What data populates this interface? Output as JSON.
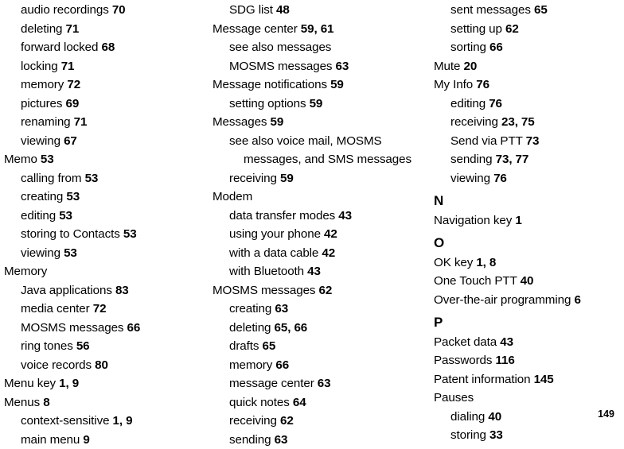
{
  "document": {
    "type": "index",
    "folio": "149"
  },
  "columns": [
    {
      "name": "column-left",
      "entries": [
        {
          "level": 1,
          "text": "audio recordings ",
          "pages": "70"
        },
        {
          "level": 1,
          "text": "deleting ",
          "pages": "71"
        },
        {
          "level": 1,
          "text": "forward locked ",
          "pages": "68"
        },
        {
          "level": 1,
          "text": "locking ",
          "pages": "71"
        },
        {
          "level": 1,
          "text": "memory ",
          "pages": "72"
        },
        {
          "level": 1,
          "text": "pictures ",
          "pages": "69"
        },
        {
          "level": 1,
          "text": "renaming ",
          "pages": "71"
        },
        {
          "level": 1,
          "text": "viewing ",
          "pages": "67"
        },
        {
          "level": 0,
          "text": "Memo ",
          "pages": "53"
        },
        {
          "level": 1,
          "text": "calling from ",
          "pages": "53"
        },
        {
          "level": 1,
          "text": "creating ",
          "pages": "53"
        },
        {
          "level": 1,
          "text": "editing ",
          "pages": "53"
        },
        {
          "level": 1,
          "text": "storing to Contacts ",
          "pages": "53"
        },
        {
          "level": 1,
          "text": "viewing ",
          "pages": "53"
        },
        {
          "level": 0,
          "text": "Memory",
          "pages": ""
        },
        {
          "level": 1,
          "text": "Java applications ",
          "pages": "83"
        },
        {
          "level": 1,
          "text": "media center ",
          "pages": "72"
        },
        {
          "level": 1,
          "text": "MOSMS messages ",
          "pages": "66"
        },
        {
          "level": 1,
          "text": "ring tones ",
          "pages": "56"
        },
        {
          "level": 1,
          "text": "voice records ",
          "pages": "80"
        },
        {
          "level": 0,
          "text": "Menu key ",
          "pages": "1, 9"
        },
        {
          "level": 0,
          "text": "Menus ",
          "pages": "8"
        },
        {
          "level": 1,
          "text": "context-sensitive ",
          "pages": "1, 9"
        },
        {
          "level": 1,
          "text": "main menu ",
          "pages": "9"
        }
      ]
    },
    {
      "name": "column-middle",
      "entries": [
        {
          "level": 1,
          "text": "SDG list ",
          "pages": "48"
        },
        {
          "level": 0,
          "text": "Message center ",
          "pages": "59, 61"
        },
        {
          "level": 1,
          "text": "see also messages",
          "pages": ""
        },
        {
          "level": 1,
          "text": "MOSMS messages ",
          "pages": "63"
        },
        {
          "level": 0,
          "text": "Message notifications ",
          "pages": "59"
        },
        {
          "level": 1,
          "text": "setting options ",
          "pages": "59"
        },
        {
          "level": 0,
          "text": "Messages ",
          "pages": "59"
        },
        {
          "level": 1,
          "wrap": true,
          "text": "see also voice mail, MOSMS messages, and SMS messages",
          "pages": ""
        },
        {
          "level": 1,
          "text": "receiving ",
          "pages": "59"
        },
        {
          "level": 0,
          "text": "Modem",
          "pages": ""
        },
        {
          "level": 1,
          "text": "data transfer modes ",
          "pages": "43"
        },
        {
          "level": 1,
          "text": "using your phone ",
          "pages": "42"
        },
        {
          "level": 1,
          "text": "with a data cable ",
          "pages": "42"
        },
        {
          "level": 1,
          "text": "with Bluetooth ",
          "pages": "43"
        },
        {
          "level": 0,
          "text": "MOSMS messages ",
          "pages": "62"
        },
        {
          "level": 1,
          "text": "creating ",
          "pages": "63"
        },
        {
          "level": 1,
          "text": "deleting ",
          "pages": "65, 66"
        },
        {
          "level": 1,
          "text": "drafts ",
          "pages": "65"
        },
        {
          "level": 1,
          "text": "memory ",
          "pages": "66"
        },
        {
          "level": 1,
          "text": "message center ",
          "pages": "63"
        },
        {
          "level": 1,
          "text": "quick notes ",
          "pages": "64"
        },
        {
          "level": 1,
          "text": "receiving ",
          "pages": "62"
        },
        {
          "level": 1,
          "text": "sending ",
          "pages": "63"
        }
      ]
    },
    {
      "name": "column-right",
      "entries": [
        {
          "level": 1,
          "text": "sent messages ",
          "pages": "65"
        },
        {
          "level": 1,
          "text": "setting up ",
          "pages": "62"
        },
        {
          "level": 1,
          "text": "sorting ",
          "pages": "66"
        },
        {
          "level": 0,
          "text": "Mute ",
          "pages": "20"
        },
        {
          "level": 0,
          "text": "My Info ",
          "pages": "76"
        },
        {
          "level": 1,
          "text": "editing ",
          "pages": "76"
        },
        {
          "level": 1,
          "text": "receiving ",
          "pages": "23, 75"
        },
        {
          "level": 1,
          "text": "Send via PTT ",
          "pages": "73"
        },
        {
          "level": 1,
          "text": "sending ",
          "pages": "73, 77"
        },
        {
          "level": 1,
          "text": "viewing ",
          "pages": "76"
        },
        {
          "letter": "N"
        },
        {
          "level": 0,
          "text": "Navigation key ",
          "pages": "1"
        },
        {
          "letter": "O"
        },
        {
          "level": 0,
          "text": "OK key ",
          "pages": "1, 8"
        },
        {
          "level": 0,
          "text": "One Touch PTT ",
          "pages": "40"
        },
        {
          "level": 0,
          "text": "Over-the-air programming ",
          "pages": "6"
        },
        {
          "letter": "P"
        },
        {
          "level": 0,
          "text": "Packet data ",
          "pages": "43"
        },
        {
          "level": 0,
          "text": "Passwords ",
          "pages": "116"
        },
        {
          "level": 0,
          "text": "Patent information ",
          "pages": "145"
        },
        {
          "level": 0,
          "text": "Pauses",
          "pages": ""
        },
        {
          "level": 1,
          "text": "dialing ",
          "pages": "40"
        },
        {
          "level": 1,
          "text": "storing ",
          "pages": "33"
        }
      ]
    }
  ]
}
